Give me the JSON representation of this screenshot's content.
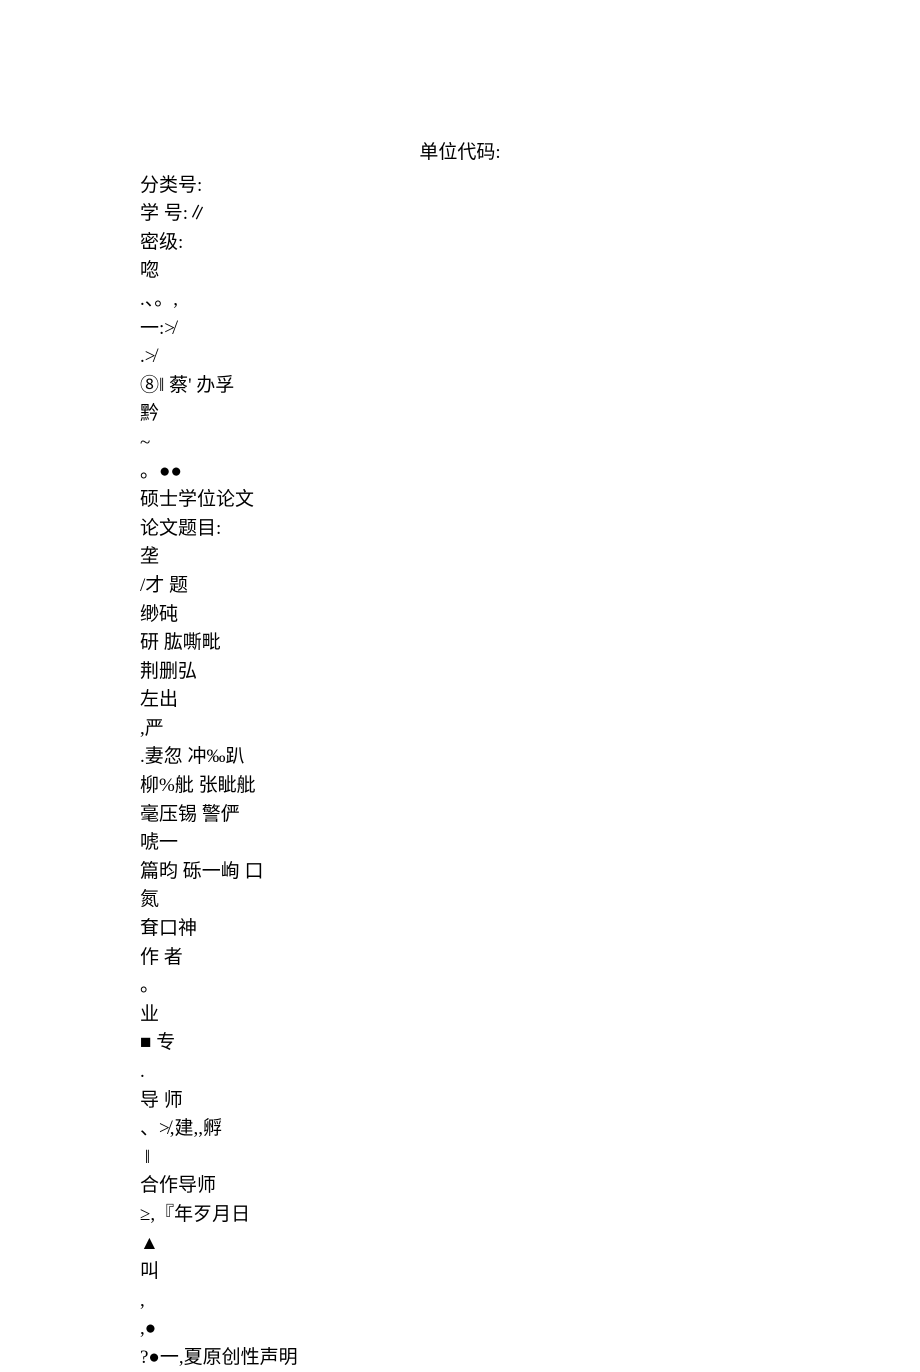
{
  "title": "单位代码:",
  "lines": [
    "分类号:",
    "学 号:∥",
    "密级:",
    "唿",
    ".、。,",
    "一:≯",
    ".≯",
    "⑧‖ 蔡' 办孚",
    "黔",
    "~",
    "。●●",
    "硕士学位论文",
    "论文题目:",
    "垄",
    "/才 题",
    "缈砘",
    "研 肱嘶毗",
    "荆删弘",
    "左出",
    ",严",
    ".妻忽 冲‰趴",
    "柳%舭 张眦舭",
    "毫压锡 警俨",
    "唬一",
    "篇昀 砾一峋 口",
    "氮",
    "耷口神",
    "作 者",
    "。",
    "业",
    "■ 专",
    ".",
    "导 师",
    "、≯,建,,孵",
    " ‖",
    "合作导师",
    "≥,『年歹月日",
    "▲",
    "叫",
    ",",
    ",●",
    "?●一,夏原创性声明"
  ]
}
